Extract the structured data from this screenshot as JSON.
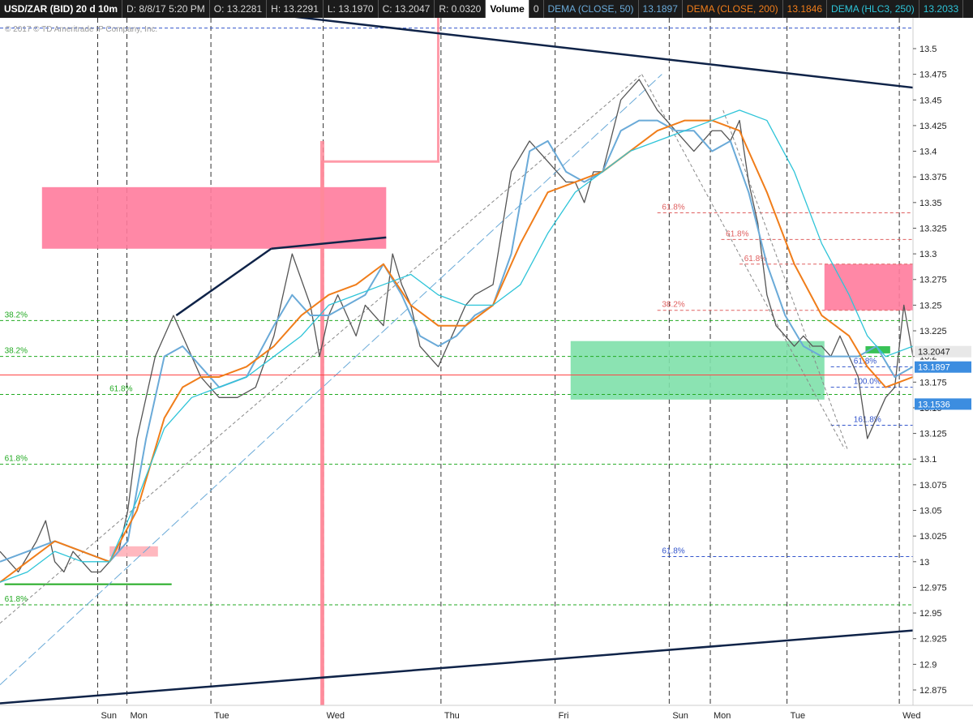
{
  "header": {
    "symbol": "USD/ZAR (BID) 20 d 10m",
    "date": "D: 8/8/17 5:20 PM",
    "open": "O: 13.2281",
    "high": "H: 13.2291",
    "low": "L: 13.1970",
    "close": "C: 13.2047",
    "range": "R: 0.0320",
    "volume_label": "Volume",
    "volume_value": "0",
    "dema50_label": "DEMA (CLOSE, 50)",
    "dema50_value": "13.1897",
    "dema200_label": "DEMA (CLOSE, 200)",
    "dema200_value": "13.1846",
    "dema250_label": "DEMA (HLC3, 250)",
    "dema250_value": "13.2033",
    "collapse_icon": "collapse-arrows-icon"
  },
  "copyright": "© 2017 © TD Ameritrade IP Company, Inc.",
  "colors": {
    "background": "#ffffff",
    "price": "#555555",
    "dema50": "#6aaad8",
    "dema200": "#f07d1a",
    "dema250": "#2ec4d8",
    "supply_zone": "#ff7b9c",
    "demand_zone": "#7ee0aa",
    "trendline": "#0f2348",
    "fib_green": "#22aa22",
    "fib_red": "#e06060",
    "fib_blue": "#3355cc"
  },
  "chart_data": {
    "type": "line",
    "ylim": [
      12.86,
      13.53
    ],
    "x_ticks": [
      "Sun",
      "Mon",
      "Tue",
      "Wed",
      "Thu",
      "Fri",
      "Sun",
      "Mon",
      "Tue",
      "Wed"
    ],
    "y_ticks": [
      "12.875",
      "12.9",
      "12.925",
      "12.95",
      "12.975",
      "13",
      "13.025",
      "13.05",
      "13.075",
      "13.1",
      "13.125",
      "13.15",
      "13.175",
      "13.2",
      "13.225",
      "13.25",
      "13.275",
      "13.3",
      "13.325",
      "13.35",
      "13.375",
      "13.4",
      "13.425",
      "13.45",
      "13.475",
      "13.5"
    ],
    "y_tick_values": [
      12.875,
      12.9,
      12.925,
      12.95,
      12.975,
      13.0,
      13.025,
      13.05,
      13.075,
      13.1,
      13.125,
      13.15,
      13.175,
      13.2,
      13.225,
      13.25,
      13.275,
      13.3,
      13.325,
      13.35,
      13.375,
      13.4,
      13.425,
      13.45,
      13.475,
      13.5
    ],
    "price_labels": [
      {
        "text": "13.2047",
        "value": 13.2047,
        "color": "#e8e8e8",
        "text_color": "#222222"
      },
      {
        "text": "13.1897",
        "value": 13.1897,
        "color": "#3c8de0",
        "text_color": "#ffffff"
      },
      {
        "text": "13.1536",
        "value": 13.1536,
        "color": "#3c8de0",
        "text_color": "#ffffff"
      }
    ],
    "series": [
      {
        "name": "price",
        "x": [
          0,
          2,
          4,
          5,
          6,
          7,
          8,
          9,
          10,
          11,
          12,
          13,
          14,
          15,
          17,
          19,
          21,
          22,
          23,
          24,
          26,
          28,
          30,
          32,
          34,
          35,
          36,
          37,
          38,
          39,
          40,
          41,
          42,
          43,
          44,
          45,
          46,
          47,
          48,
          49,
          50,
          51,
          52,
          54,
          56,
          58,
          60,
          62,
          63,
          64,
          65,
          66,
          68,
          70,
          72,
          74,
          75,
          76,
          77,
          78,
          79,
          80,
          81,
          82,
          83,
          84,
          85,
          86,
          87,
          88,
          89,
          90,
          91,
          92,
          93,
          94,
          95,
          96,
          97,
          98,
          99,
          100
        ],
        "y": [
          13.01,
          12.99,
          13.02,
          13.04,
          13.0,
          12.99,
          13.01,
          13.0,
          12.99,
          12.99,
          13.0,
          13.01,
          13.05,
          13.12,
          13.2,
          13.24,
          13.2,
          13.18,
          13.17,
          13.16,
          13.16,
          13.17,
          13.22,
          13.3,
          13.25,
          13.2,
          13.24,
          13.26,
          13.24,
          13.22,
          13.25,
          13.24,
          13.23,
          13.3,
          13.27,
          13.25,
          13.21,
          13.2,
          13.19,
          13.21,
          13.23,
          13.25,
          13.26,
          13.27,
          13.38,
          13.41,
          13.39,
          13.37,
          13.37,
          13.35,
          13.38,
          13.38,
          13.45,
          13.47,
          13.44,
          13.42,
          13.41,
          13.4,
          13.41,
          13.42,
          13.42,
          13.41,
          13.43,
          13.37,
          13.33,
          13.26,
          13.23,
          13.22,
          13.21,
          13.22,
          13.21,
          13.21,
          13.2,
          13.22,
          13.2,
          13.18,
          13.12,
          13.14,
          13.16,
          13.17,
          13.25,
          13.2
        ]
      },
      {
        "name": "DEMA (CLOSE, 50)",
        "x": [
          0,
          3,
          6,
          9,
          12,
          14,
          16,
          18,
          20,
          22,
          24,
          27,
          30,
          32,
          34,
          36,
          38,
          40,
          42,
          44,
          46,
          48,
          50,
          52,
          54,
          56,
          58,
          60,
          62,
          64,
          66,
          68,
          70,
          72,
          74,
          76,
          78,
          80,
          82,
          84,
          86,
          88,
          90,
          92,
          94,
          96,
          98,
          100
        ],
        "y": [
          13.0,
          13.01,
          13.02,
          13.01,
          13.0,
          13.02,
          13.12,
          13.2,
          13.21,
          13.19,
          13.17,
          13.18,
          13.23,
          13.26,
          13.24,
          13.24,
          13.25,
          13.26,
          13.29,
          13.26,
          13.22,
          13.21,
          13.22,
          13.24,
          13.25,
          13.3,
          13.4,
          13.41,
          13.38,
          13.37,
          13.38,
          13.42,
          13.43,
          13.43,
          13.42,
          13.42,
          13.4,
          13.41,
          13.36,
          13.29,
          13.24,
          13.21,
          13.2,
          13.2,
          13.2,
          13.21,
          13.18,
          13.19
        ]
      },
      {
        "name": "DEMA (CLOSE, 200)",
        "x": [
          0,
          3,
          6,
          9,
          12,
          15,
          18,
          20,
          22,
          24,
          27,
          30,
          33,
          36,
          39,
          42,
          45,
          48,
          51,
          54,
          57,
          60,
          63,
          66,
          69,
          72,
          75,
          78,
          81,
          84,
          87,
          90,
          93,
          95,
          97,
          100
        ],
        "y": [
          12.98,
          13.0,
          13.02,
          13.01,
          13.0,
          13.05,
          13.14,
          13.17,
          13.18,
          13.18,
          13.19,
          13.21,
          13.24,
          13.26,
          13.27,
          13.29,
          13.25,
          13.23,
          13.23,
          13.25,
          13.31,
          13.36,
          13.37,
          13.38,
          13.4,
          13.42,
          13.43,
          13.43,
          13.42,
          13.36,
          13.29,
          13.24,
          13.22,
          13.19,
          13.17,
          13.18
        ]
      },
      {
        "name": "DEMA (HLC3, 250)",
        "x": [
          0,
          3,
          6,
          9,
          12,
          15,
          18,
          21,
          24,
          27,
          30,
          33,
          36,
          39,
          42,
          45,
          48,
          51,
          54,
          57,
          60,
          63,
          66,
          69,
          72,
          75,
          78,
          81,
          84,
          87,
          90,
          93,
          95,
          97,
          100
        ],
        "y": [
          12.98,
          12.99,
          13.01,
          13.0,
          13.0,
          13.06,
          13.13,
          13.16,
          13.17,
          13.18,
          13.2,
          13.22,
          13.25,
          13.26,
          13.27,
          13.28,
          13.26,
          13.25,
          13.25,
          13.27,
          13.32,
          13.36,
          13.38,
          13.4,
          13.41,
          13.42,
          13.43,
          13.44,
          13.43,
          13.38,
          13.31,
          13.26,
          13.22,
          13.2,
          13.21
        ]
      }
    ],
    "fib_levels": [
      {
        "text": "38.2%",
        "value": 13.235,
        "color": "#22aa22",
        "from": 0,
        "to": 100,
        "label_x": 0.5
      },
      {
        "text": "38.2%",
        "value": 13.2,
        "color": "#22aa22",
        "from": 0,
        "to": 100,
        "label_x": 0.5
      },
      {
        "text": "61.8%",
        "value": 13.163,
        "color": "#22aa22",
        "from": 0,
        "to": 100,
        "label_x": 12
      },
      {
        "text": "61.8%",
        "value": 13.095,
        "color": "#22aa22",
        "from": 0,
        "to": 100,
        "label_x": 0.5
      },
      {
        "text": "61.8%",
        "value": 12.958,
        "color": "#22aa22",
        "from": 0,
        "to": 100,
        "label_x": 0.5
      },
      {
        "text": "61.8%",
        "value": 13.34,
        "color": "#e06060",
        "from": 72,
        "to": 100,
        "label_x": 72.5
      },
      {
        "text": "61.8%",
        "value": 13.314,
        "color": "#e06060",
        "from": 79,
        "to": 100,
        "label_x": 79.5
      },
      {
        "text": "61.8%",
        "value": 13.29,
        "color": "#e06060",
        "from": 81,
        "to": 100,
        "label_x": 81.5
      },
      {
        "text": "38.2%",
        "value": 13.245,
        "color": "#e06060",
        "from": 72,
        "to": 100,
        "label_x": 72.5
      },
      {
        "text": "61.8%",
        "value": 13.19,
        "color": "#3355cc",
        "from": 91,
        "to": 100,
        "label_x": 93.5
      },
      {
        "text": "100.0%",
        "value": 13.17,
        "color": "#3355cc",
        "from": 91,
        "to": 100,
        "label_x": 93.5
      },
      {
        "text": "161.8%",
        "value": 13.133,
        "color": "#3355cc",
        "from": 91,
        "to": 100,
        "label_x": 93.5
      },
      {
        "text": "61.8%",
        "value": 13.005,
        "color": "#3355cc",
        "from": 72.5,
        "to": 100,
        "label_x": 72.5
      },
      {
        "text": "",
        "value": 13.52,
        "color": "#3355cc",
        "from": 0,
        "to": 100,
        "label_x": 0
      }
    ],
    "zones": [
      {
        "x0": 4.6,
        "x1": 42.3,
        "y0": 13.305,
        "y1": 13.365,
        "color": "#ff7b9c"
      },
      {
        "x0": 90.3,
        "x1": 100,
        "y0": 13.245,
        "y1": 13.29,
        "color": "#ff7b9c"
      },
      {
        "x0": 62.5,
        "x1": 90.3,
        "y0": 13.158,
        "y1": 13.215,
        "color": "#7ee0aa"
      },
      {
        "x0": 12,
        "x1": 17.3,
        "y0": 13.005,
        "y1": 13.015,
        "color": "#ffb0b8"
      },
      {
        "x0": 94.8,
        "x1": 97.5,
        "y0": 13.203,
        "y1": 13.21,
        "color": "#22bb44"
      }
    ],
    "trendlines": [
      {
        "x0": 19.3,
        "y0": 13.24,
        "x1": 29.7,
        "y1": 13.305,
        "color": "#0f2348",
        "width": 2.5
      },
      {
        "x0": 29.7,
        "y0": 13.305,
        "x1": 42.3,
        "y1": 13.316,
        "color": "#0f2348",
        "width": 2.5
      },
      {
        "x0": 18.5,
        "y0": 13.545,
        "x1": 100,
        "y1": 13.462,
        "color": "#0f2348",
        "width": 2.5
      },
      {
        "x0": 0,
        "y0": 12.862,
        "x1": 100,
        "y1": 12.933,
        "color": "#0f2348",
        "width": 2.5
      },
      {
        "x0": 0.5,
        "y0": 12.978,
        "x1": 18.8,
        "y1": 12.978,
        "color": "#22aa22",
        "width": 2
      },
      {
        "x0": 0,
        "y0": 12.94,
        "x1": 70.3,
        "y1": 13.475,
        "color": "#888888",
        "width": 1,
        "dash": "4,3"
      },
      {
        "x0": 0,
        "y0": 12.88,
        "x1": 72.5,
        "y1": 13.475,
        "color": "#6aaad8",
        "width": 1,
        "dash": "12,4"
      },
      {
        "x0": 70.3,
        "y0": 13.475,
        "x1": 92.5,
        "y1": 13.11,
        "color": "#888888",
        "width": 1,
        "dash": "4,3"
      },
      {
        "x0": 79.2,
        "y0": 13.44,
        "x1": 92.8,
        "y1": 13.11,
        "color": "#888888",
        "width": 1,
        "dash": "4,3"
      }
    ],
    "steps": [
      {
        "points": [
          [
            35.3,
            12.86
          ],
          [
            35.3,
            13.39
          ],
          [
            48,
            13.39
          ],
          [
            48,
            13.53
          ]
        ],
        "color": "#ff8a9a",
        "width": 3
      },
      {
        "points": [
          [
            35.3,
            12.86
          ],
          [
            35.3,
            13.41
          ]
        ],
        "color": "#ff8a9a",
        "width": 5
      }
    ],
    "hline_current": {
      "value": 13.182,
      "color": "#ff4444"
    }
  }
}
